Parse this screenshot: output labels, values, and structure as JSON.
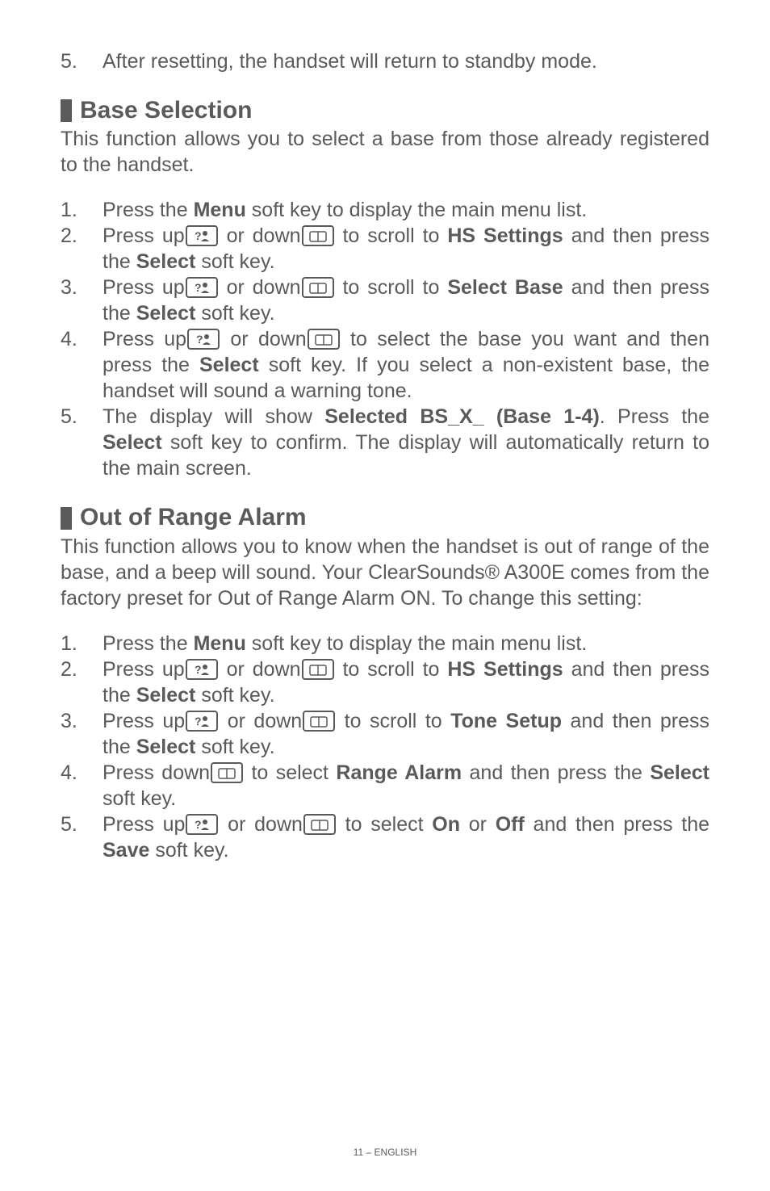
{
  "intro_step": {
    "num": "5.",
    "text": "After resetting, the handset will return to standby mode."
  },
  "section1": {
    "heading": "Base Selection",
    "intro": "This function allows you to select a base from those already registered to the handset.",
    "steps": [
      {
        "num": "1.",
        "pre": "Press the ",
        "b1": "Menu",
        "post": " soft key to display the main menu list."
      },
      {
        "num": "2.",
        "pre": "Press up",
        "mid1": " or down",
        "mid2": " to scroll to ",
        "b1": "HS Settings",
        "post": " and then press the ",
        "b2": "Select",
        "tail": " soft key."
      },
      {
        "num": "3.",
        "pre": "Press up",
        "mid1": " or down",
        "mid2": " to scroll to ",
        "b1": "Select Base",
        "post": " and then press the ",
        "b2": "Select",
        "tail": " soft key."
      },
      {
        "num": "4.",
        "pre": "Press up",
        "mid1": " or down",
        "mid2": " to select the base you want and then press the ",
        "b1": "Select",
        "post": " soft key.  If you select a non-existent base, the handset will sound a warning tone."
      },
      {
        "num": "5.",
        "pre": "The display will show ",
        "b1": "Selected BS_X_ (Base 1-4)",
        "post": ".  Press the ",
        "b2": "Select",
        "tail": " soft key to confirm.  The display will automatically return to the main screen."
      }
    ]
  },
  "section2": {
    "heading": "Out of Range Alarm",
    "intro": "This function allows you to know when the handset is out of range of the base, and a beep will sound.  Your ClearSounds® A300E comes from the factory preset for Out of Range Alarm ON.  To change this setting:",
    "steps": [
      {
        "num": "1.",
        "pre": "Press the ",
        "b1": "Menu",
        "post": " soft key to display the main menu list."
      },
      {
        "num": "2.",
        "pre": "Press up",
        "mid1": " or down",
        "mid2": " to scroll to ",
        "b1": "HS Settings",
        "post": " and then press the ",
        "b2": "Select",
        "tail": " soft key."
      },
      {
        "num": "3.",
        "pre": "Press up",
        "mid1": " or down",
        "mid2": " to scroll to ",
        "b1": "Tone Setup",
        "post": " and then press the ",
        "b2": "Select",
        "tail": " soft key."
      },
      {
        "num": "4.",
        "pre": "Press down",
        "mid2": " to select ",
        "b1": "Range Alarm",
        "post": " and then press the ",
        "b2": "Select",
        "tail": " soft key."
      },
      {
        "num": "5.",
        "pre": "Press up",
        "mid1": " or down",
        "mid2": " to select ",
        "b1": "On",
        "post": " or ",
        "b2": "Off",
        "tail": " and then press the ",
        "b3": "Save",
        "tail2": " soft key."
      }
    ]
  },
  "footer": "11 – ENGLISH"
}
